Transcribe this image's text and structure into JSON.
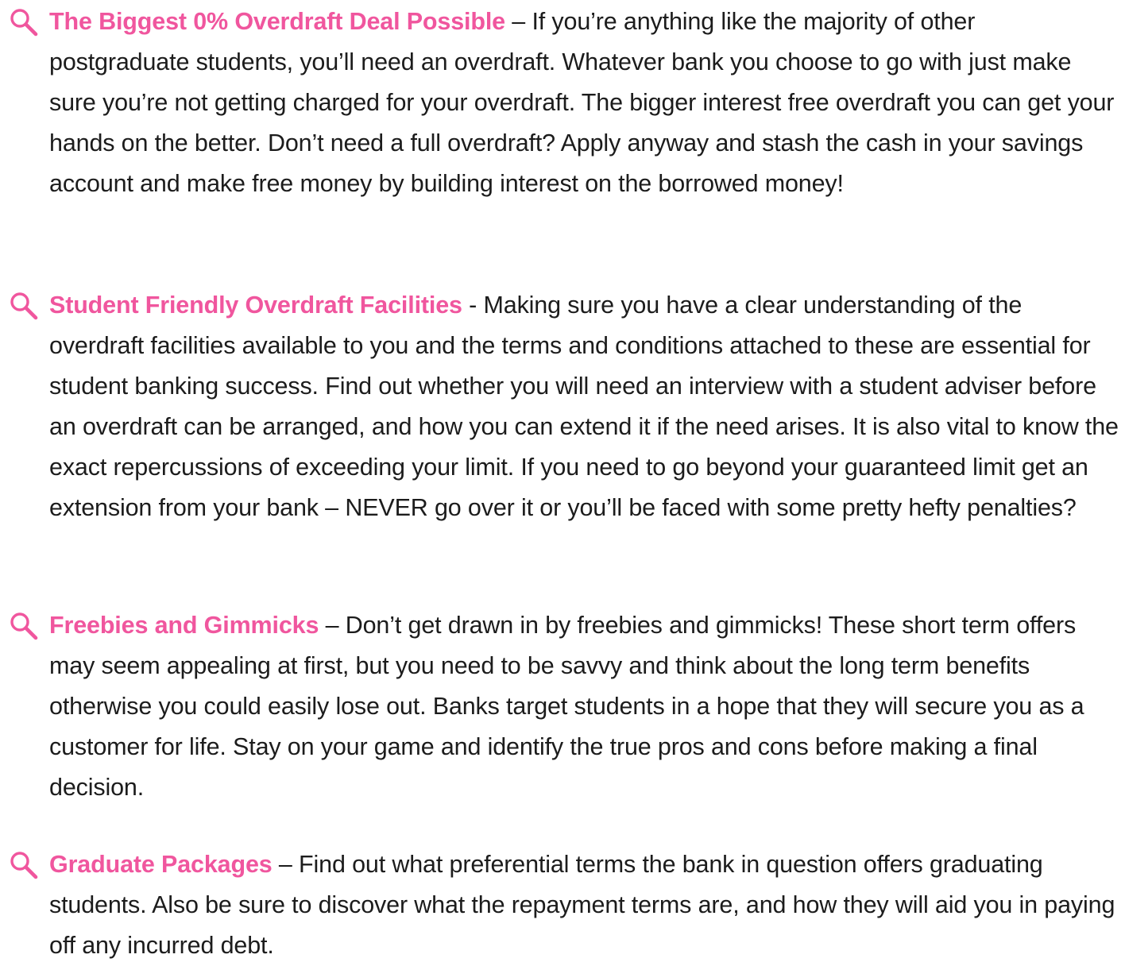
{
  "colors": {
    "accent": "#f0569e",
    "text": "#1c1c1c"
  },
  "items": [
    {
      "icon": "magnifier-icon",
      "title": "The Biggest 0% Overdraft Deal Possible",
      "body": " – If you’re anything like the majority of other postgraduate students, you’ll need an overdraft. Whatever bank you choose to go with just make sure you’re not getting charged for your overdraft. The bigger interest free overdraft you can get your hands on the better. Don’t need a full overdraft? Apply anyway and stash the cash in your savings account and make free money by building interest on the borrowed money!"
    },
    {
      "icon": "magnifier-icon",
      "title": "Student Friendly Overdraft Facilities",
      "body": " - Making sure you have a clear understanding of the overdraft facilities available to you and the terms and conditions attached to these are essential for student banking success. Find out whether you will need an interview with a student adviser before an overdraft can be arranged, and how you can extend it if the need arises. It is also vital to know the exact repercussions of exceeding your limit. If you need to go beyond your guaranteed limit get an extension from your bank – NEVER go over it or you’ll be faced with some pretty hefty penalties?"
    },
    {
      "icon": "magnifier-icon",
      "title": "Freebies and Gimmicks",
      "body": " – Don’t get drawn in by freebies and gimmicks! These short term offers may seem appealing at first, but you need to be savvy and think about the long term benefits otherwise you could easily lose out. Banks target students in a hope that they will secure you as a customer for life. Stay on your game and identify the true pros and cons before making a final decision."
    },
    {
      "icon": "magnifier-icon",
      "title": "Graduate Packages",
      "body": " – Find out what preferential terms the bank in question offers graduating students. Also be sure to discover what the repayment terms are, and how they will aid you in paying off any incurred debt."
    }
  ]
}
